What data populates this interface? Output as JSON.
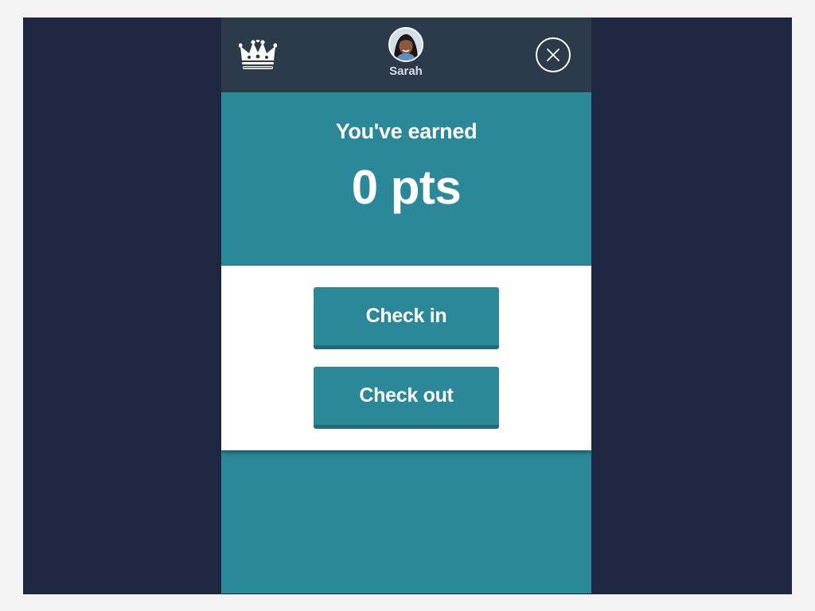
{
  "header": {
    "user_name": "Sarah",
    "crown_icon": "crown-icon",
    "close_icon": "close-icon"
  },
  "summary": {
    "earned_label": "You've earned",
    "points_text": "0 pts"
  },
  "actions": {
    "check_in_label": "Check in",
    "check_out_label": "Check out"
  },
  "colors": {
    "backdrop": "#1f2642",
    "topbar": "#2c3b4a",
    "accent": "#2b8898",
    "accent_dark": "#1e6b79"
  }
}
